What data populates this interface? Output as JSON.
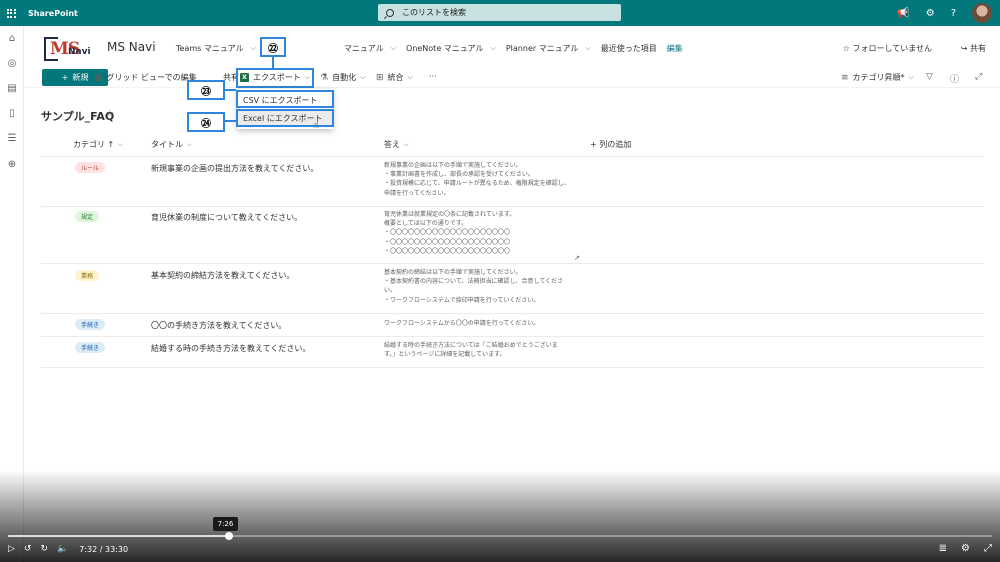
{
  "suitebar": {
    "app_title": "SharePoint",
    "search_placeholder": "このリストを検索",
    "icons": [
      "waffle-icon",
      "megaphone-icon",
      "gear-icon",
      "help-icon",
      "avatar"
    ]
  },
  "rail": {
    "icons": [
      "home-icon",
      "globe-icon",
      "news-icon",
      "file-icon",
      "list-icon",
      "add-icon"
    ]
  },
  "site": {
    "name": "MS Navi",
    "logo_ms": "MS",
    "logo_navi": "Navi",
    "nav": [
      {
        "label": "Teams マニュアル",
        "has_chevron": true
      },
      {
        "label": "マニュアル",
        "has_chevron": true
      },
      {
        "label": "OneNote マニュアル",
        "has_chevron": true
      },
      {
        "label": "Planner マニュアル",
        "has_chevron": true
      },
      {
        "label": "最近使った項目",
        "has_chevron": false
      },
      {
        "label": "編集",
        "has_chevron": false
      }
    ],
    "follow_label": "☆ フォローしていません",
    "share_label": "共有"
  },
  "commandbar": {
    "new_label": "新規",
    "grid_edit_label": "グリッド ビューでの編集",
    "share_label": "共有",
    "export_label": "エクスポート",
    "automate_label": "自動化",
    "integrate_label": "統合",
    "more_label": "···",
    "view_label": "カテゴリ昇順*"
  },
  "export_menu": {
    "csv_label": "CSV にエクスポート",
    "excel_label": "Excel にエクスポート"
  },
  "callouts": {
    "c22": "㉒",
    "c23": "㉓",
    "c24": "㉔"
  },
  "list": {
    "title": "サンプル_FAQ",
    "columns": {
      "category": "カテゴリ ↑",
      "title": "タイトル",
      "answer": "答え",
      "add_column": "+ 列の追加"
    },
    "rows": [
      {
        "category": "ルール",
        "title": "新規事業の企画の提出方法を教えてください。",
        "answer": "新規事業の企画は以下の手順で実施してください。\n・事業計画書を作成し、部長の承認を受けてください。\n・投資規模に応じて、申請ルートが異なるため、権限規定を確認し、\n申請を行ってください。"
      },
      {
        "category": "規定",
        "title": "育児休業の制度について教えてください。",
        "answer": "育児休業は就業規定の〇条に記載されています。\n概要としては以下の通りです。\n・〇〇〇〇〇〇〇〇〇〇〇〇〇〇〇〇〇〇〇〇\n・〇〇〇〇〇〇〇〇〇〇〇〇〇〇〇〇〇〇〇〇\n・〇〇〇〇〇〇〇〇〇〇〇〇〇〇〇〇〇〇〇〇"
      },
      {
        "category": "業務",
        "title": "基本契約の締結方法を教えてください。",
        "answer": "基本契約の締結は以下の手順で実施してください。\n・基本契約書の内容について、法務担当に確認し、合意してくださ\nい。\n・ワークフローシステムで捺印申請を行っていください。"
      },
      {
        "category": "手続き",
        "title": "〇〇の手続き方法を教えてください。",
        "answer": "ワークフローシステムから〇〇の申請を行ってください。"
      },
      {
        "category": "手続き",
        "title": "結婚する時の手続き方法を教えてください。",
        "answer": "結婚する時の手続き方法については「ご結婚おめでとうございま\nす。」というページに詳細を記載しています。"
      }
    ]
  },
  "video": {
    "tooltip_time": "7:26",
    "current_time": "7:32 / 33:30",
    "progress": 0.225
  },
  "colors": {
    "accent": "#03787c",
    "badge_rule_bg": "#fde2e4",
    "badge_rule_fg": "#c0392b",
    "badge_kitei_bg": "#dff6dd",
    "badge_kitei_fg": "#2e7d32",
    "badge_gyomu_bg": "#fff4ce",
    "badge_gyomu_fg": "#8a6d00",
    "badge_tetsuzuki_bg": "#deecf9",
    "badge_tetsuzuki_fg": "#0b5cab",
    "callout": "#2e86de"
  }
}
